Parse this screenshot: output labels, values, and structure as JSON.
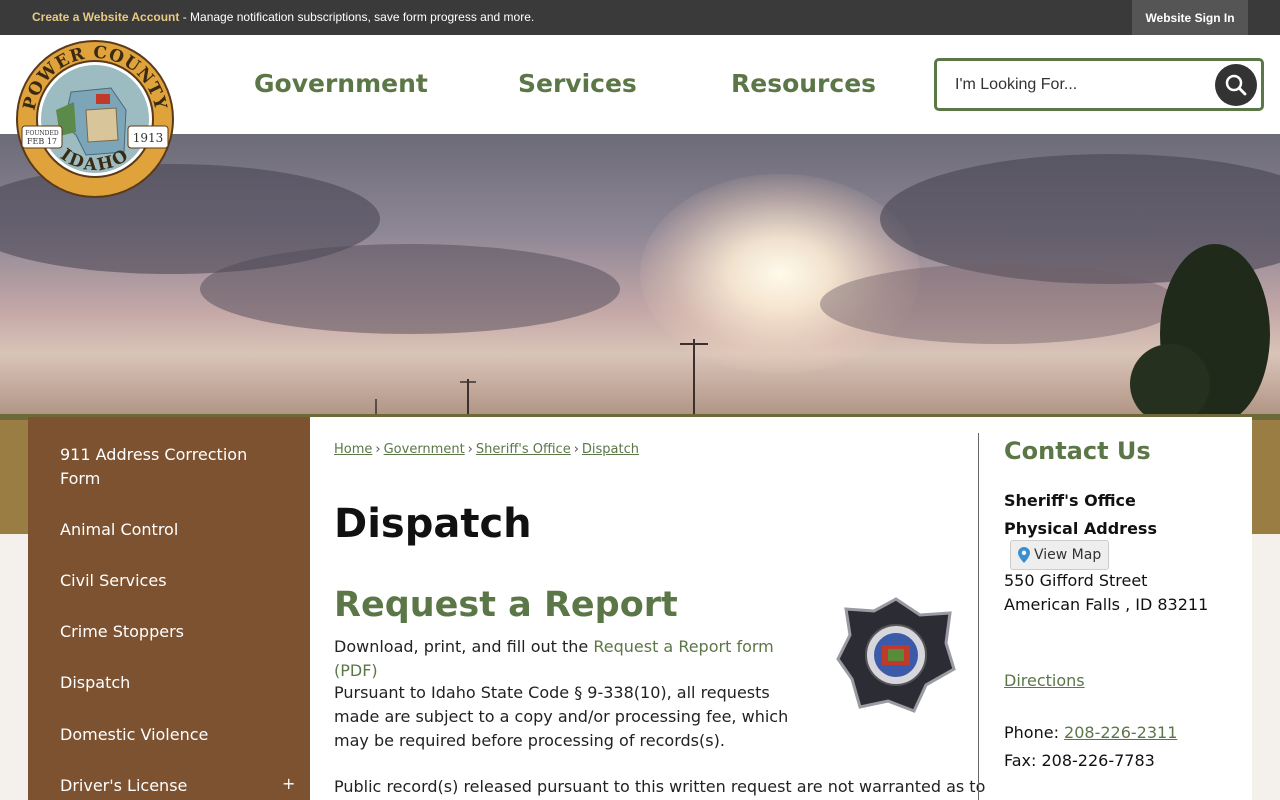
{
  "topbar": {
    "account_link": "Create a Website Account",
    "message": " - Manage notification subscriptions, save form progress and more.",
    "signin": "Website Sign In"
  },
  "logo": {
    "name_top": "POWER COUNTY",
    "name_bottom": "IDAHO",
    "founded_label": "FOUNDED",
    "founded_date": "FEB 17",
    "year": "1913"
  },
  "nav": {
    "items": [
      "Government",
      "Services",
      "Resources"
    ]
  },
  "search": {
    "placeholder": "I'm Looking For..."
  },
  "sidebar": {
    "items": [
      {
        "label": "911 Address Correction Form"
      },
      {
        "label": "Animal Control"
      },
      {
        "label": "Civil Services"
      },
      {
        "label": "Crime Stoppers"
      },
      {
        "label": "Dispatch"
      },
      {
        "label": "Domestic Violence"
      },
      {
        "label": "Driver's License",
        "expand": "+"
      }
    ]
  },
  "breadcrumb": {
    "items": [
      "Home",
      "Government",
      "Sheriff's Office",
      "Dispatch"
    ],
    "separator": "›"
  },
  "page": {
    "title": "Dispatch",
    "section_title": "Request a Report",
    "para1_prefix": "Download, print, and fill out the ",
    "para1_link": "Request a Report form (PDF)",
    "para2": "Pursuant to Idaho State Code § 9-338(10), all requests made are subject to a copy and/or processing fee, which may be required before processing of records(s).",
    "para3": "Public record(s) released pursuant to this written request are not warranted as to"
  },
  "contact": {
    "title": "Contact Us",
    "office": "Sheriff's Office",
    "address_label": "Physical Address",
    "view_map": "View Map",
    "street": "550 Gifford Street",
    "city": "American Falls , ID 83211",
    "directions": "Directions",
    "phone_label": "Phone: ",
    "phone": "208-226-2311",
    "fax": "Fax: 208-226-7783"
  }
}
